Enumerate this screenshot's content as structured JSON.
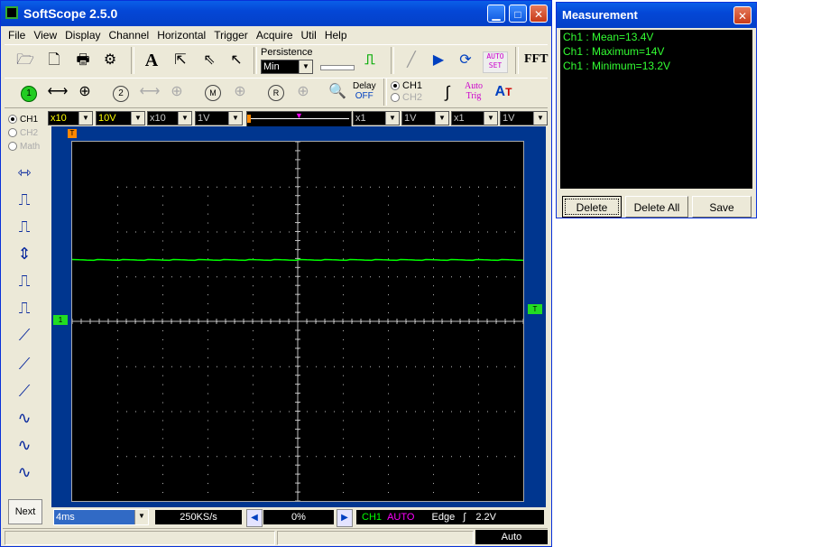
{
  "main_window": {
    "title": "SoftScope 2.5.0",
    "menu": [
      "File",
      "View",
      "Display",
      "Channel",
      "Horizontal",
      "Trigger",
      "Acquire",
      "Util",
      "Help"
    ],
    "persistence": {
      "label": "Persistence",
      "value": "Min"
    },
    "delay": {
      "line1": "Delay",
      "line2": "OFF"
    },
    "channel_radios": [
      {
        "label": "CH1",
        "selected": true
      },
      {
        "label": "CH2",
        "selected": false
      }
    ],
    "auto_trig": {
      "line1": "Auto",
      "line2": "Trig"
    },
    "auto_set": {
      "line1": "AUTO",
      "line2": "SET"
    },
    "fft_label": "FFT",
    "side_radios": [
      {
        "label": "CH1",
        "selected": true
      },
      {
        "label": "CH2",
        "selected": false
      },
      {
        "label": "Math",
        "selected": false
      }
    ],
    "channel_selects": [
      "x10",
      "10V",
      "x10",
      "1V",
      "x1",
      "1V",
      "x1",
      "1V"
    ],
    "next_button": "Next",
    "timebase": "4ms",
    "sample_rate": "250KS/s",
    "position": "0%",
    "trigger_info": {
      "channel": "CH1",
      "mode": "AUTO",
      "type": "Edge",
      "level": "2.2V"
    },
    "status": {
      "mode": "Auto"
    },
    "markers": {
      "trigger_left": "T",
      "trigger_right": "T",
      "ch1_marker": "1"
    },
    "colors": {
      "trace": "#00ff00",
      "screen": "#000000",
      "frame": "#00368f",
      "grid": "#c0c0c0"
    }
  },
  "measurement_window": {
    "title": "Measurement",
    "lines": [
      "Ch1 : Mean=13.4V",
      "Ch1 : Maximum=14V",
      "Ch1 : Minimum=13.2V"
    ],
    "buttons": [
      "Delete",
      "Delete All",
      "Save"
    ]
  }
}
